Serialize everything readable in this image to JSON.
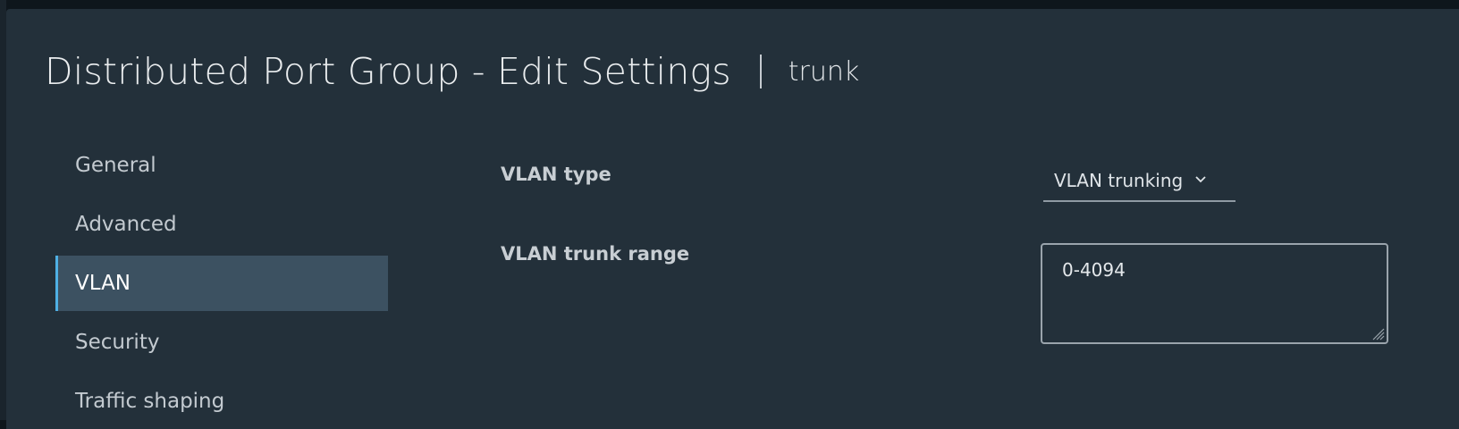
{
  "dialog": {
    "title": "Distributed Port Group - Edit Settings",
    "subtitle": "trunk"
  },
  "nav": {
    "items": [
      {
        "label": "General",
        "active": false
      },
      {
        "label": "Advanced",
        "active": false
      },
      {
        "label": "VLAN",
        "active": true
      },
      {
        "label": "Security",
        "active": false
      },
      {
        "label": "Traffic shaping",
        "active": false
      }
    ]
  },
  "form": {
    "vlan_type_label": "VLAN type",
    "vlan_type_value": "VLAN trunking",
    "trunk_range_label": "VLAN trunk range",
    "trunk_range_value": "0-4094"
  },
  "icons": {
    "dropdown": "chevron-down-icon",
    "resize": "resize-handle-icon"
  },
  "colors": {
    "background": "#23303a",
    "nav_active_bg": "#3c5161",
    "nav_active_accent": "#4fb0e4"
  }
}
